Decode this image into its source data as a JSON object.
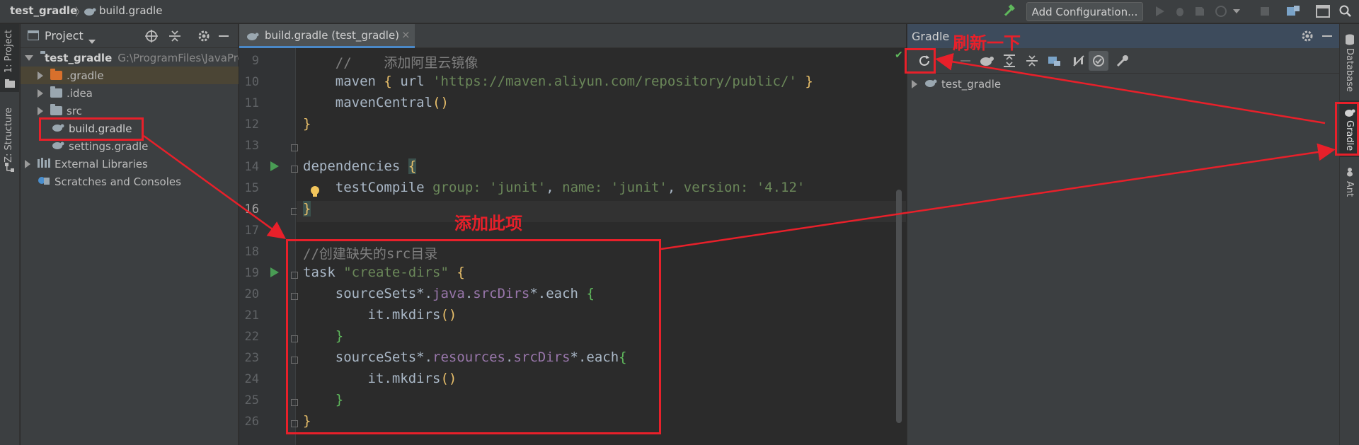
{
  "nav": {
    "project": "test_gradle",
    "file": "build.gradle",
    "add_configuration": "Add Configuration..."
  },
  "left_strip": {
    "project_tab": "1: Project",
    "structure_tab": "Z: Structure"
  },
  "right_strip": {
    "database_tab": "Database",
    "gradle_tab": "Gradle",
    "ant_tab": "Ant"
  },
  "project_panel": {
    "title": "Project",
    "root_name": "test_gradle",
    "root_path": "G:\\ProgramFiles\\JavaPro",
    "items": [
      {
        "label": ".gradle"
      },
      {
        "label": ".idea"
      },
      {
        "label": "src"
      },
      {
        "label": "build.gradle"
      },
      {
        "label": "settings.gradle"
      },
      {
        "label": "External Libraries"
      },
      {
        "label": "Scratches and Consoles"
      }
    ]
  },
  "editor": {
    "tab_label": "build.gradle (test_gradle)",
    "line_numbers": [
      "9",
      "10",
      "11",
      "12",
      "13",
      "14",
      "15",
      "16",
      "17",
      "18",
      "19",
      "20",
      "21",
      "22",
      "23",
      "24",
      "25",
      "26"
    ],
    "code": {
      "l9_comment": "//    添加阿里云镜像",
      "l10_maven": "maven",
      "l10_url_key": "url",
      "l10_url": "'https://maven.aliyun.com/repository/public/'",
      "l11": "mavenCentral",
      "l14": "dependencies",
      "l15_fn": "testCompile",
      "l15_group_key": "group:",
      "l15_group_val": "'junit'",
      "l15_name_key": "name:",
      "l15_name_val": "'junit'",
      "l15_version_key": "version:",
      "l15_version_val": "'4.12'",
      "l18_comment": "//创建缺失的src目录",
      "l19_task": "task",
      "l19_name": "\"create-dirs\"",
      "l20_src": "sourceSets*.",
      "l20_java": "java",
      "l20_dot": ".",
      "l20_dirs": "srcDirs",
      "l20_each": "*.each",
      "l21": "it.mkdirs",
      "l23_src": "sourceSets*.",
      "l23_res": "resources",
      "l23_dot": ".",
      "l23_dirs": "srcDirs",
      "l23_each": "*.each",
      "l24": "it.mkdirs"
    }
  },
  "gradle_panel": {
    "title": "Gradle",
    "project": "test_gradle"
  },
  "annotations": {
    "refresh_note": "刷新一下",
    "add_note": "添加此项"
  },
  "colors": {
    "annotation_red": "#e8202a",
    "run_green": "#499c54"
  }
}
